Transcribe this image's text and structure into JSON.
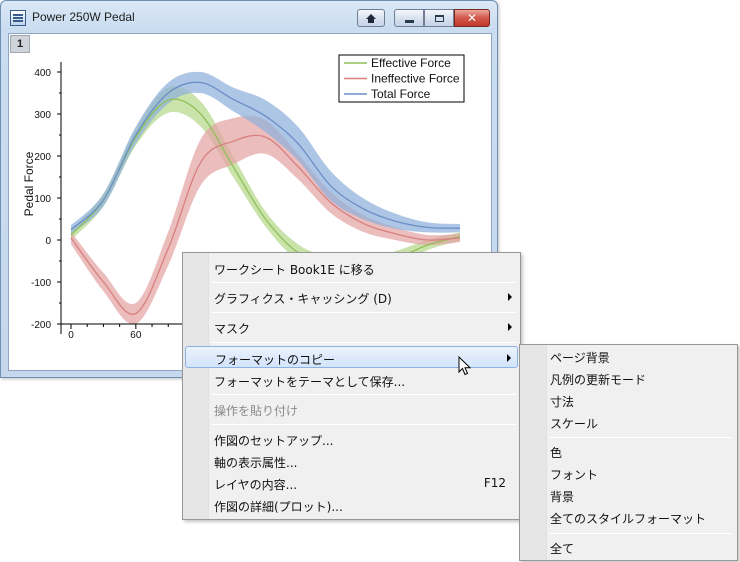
{
  "window": {
    "title": "Power 250W Pedal",
    "layer_badge": "1"
  },
  "chart_data": {
    "type": "line",
    "ylabel": "Pedal Force",
    "xlabel": "",
    "xlim": [
      0,
      360
    ],
    "ylim": [
      -250,
      450
    ],
    "y_ticks": [
      400,
      300,
      200,
      100,
      0,
      -100,
      -200
    ],
    "x_ticks_visible": [
      0,
      60
    ],
    "legend_position": "top-right",
    "series": [
      {
        "name": "Effective Force",
        "color": "#8fc15a",
        "band_color": "#b6d88b",
        "x": [
          0,
          30,
          60,
          90,
          120,
          150,
          180,
          210,
          240,
          270,
          300,
          330,
          360
        ],
        "y": [
          12,
          95,
          245,
          333,
          300,
          175,
          50,
          -30,
          -62,
          -65,
          -45,
          -12,
          8
        ],
        "band": [
          12,
          15,
          20,
          30,
          30,
          25,
          18,
          20,
          22,
          20,
          18,
          12,
          10
        ]
      },
      {
        "name": "Ineffective Force",
        "color": "#d97f7f",
        "band_color": "#e3a3a3",
        "x": [
          0,
          30,
          60,
          90,
          120,
          150,
          180,
          210,
          240,
          270,
          300,
          330,
          360
        ],
        "y": [
          5,
          -100,
          -175,
          -20,
          185,
          235,
          245,
          175,
          90,
          40,
          15,
          0,
          5
        ],
        "band": [
          15,
          22,
          25,
          40,
          55,
          55,
          40,
          30,
          25,
          20,
          15,
          12,
          10
        ]
      },
      {
        "name": "Total Force",
        "color": "#6c8fc6",
        "band_color": "#8fb0db",
        "x": [
          0,
          30,
          60,
          90,
          120,
          150,
          180,
          210,
          240,
          270,
          300,
          330,
          360
        ],
        "y": [
          25,
          95,
          250,
          350,
          375,
          335,
          295,
          230,
          130,
          75,
          45,
          30,
          28
        ],
        "band": [
          10,
          15,
          20,
          25,
          25,
          28,
          38,
          40,
          35,
          25,
          18,
          12,
          10
        ]
      }
    ]
  },
  "context_menu": {
    "items": [
      {
        "label": "ワークシート Book1E に移る",
        "submenu": false
      },
      {
        "label": "グラフィクス・キャッシング (D)",
        "submenu": true
      },
      {
        "label": "マスク",
        "submenu": true
      },
      {
        "label": "フォーマットのコピー",
        "submenu": true,
        "highlighted": true
      },
      {
        "label": "フォーマットをテーマとして保存...",
        "submenu": false
      },
      {
        "label": "操作を貼り付け",
        "disabled": true
      },
      {
        "label": "作図のセットアップ..."
      },
      {
        "label": "軸の表示属性..."
      },
      {
        "label": "レイヤの内容...",
        "shortcut": "F12"
      },
      {
        "label": "作図の詳細(プロット)..."
      }
    ]
  },
  "submenu": {
    "items": [
      {
        "label": "ページ背景"
      },
      {
        "label": "凡例の更新モード"
      },
      {
        "label": "寸法"
      },
      {
        "label": "スケール"
      },
      {
        "label": "色"
      },
      {
        "label": "フォント"
      },
      {
        "label": "背景"
      },
      {
        "label": "全てのスタイルフォーマット"
      },
      {
        "label": "全て"
      }
    ]
  },
  "icons": {
    "home": "home-icon",
    "minimize": "minimize-icon",
    "maximize": "maximize-icon",
    "close": "close-icon",
    "cursor": "mouse-cursor-icon"
  }
}
